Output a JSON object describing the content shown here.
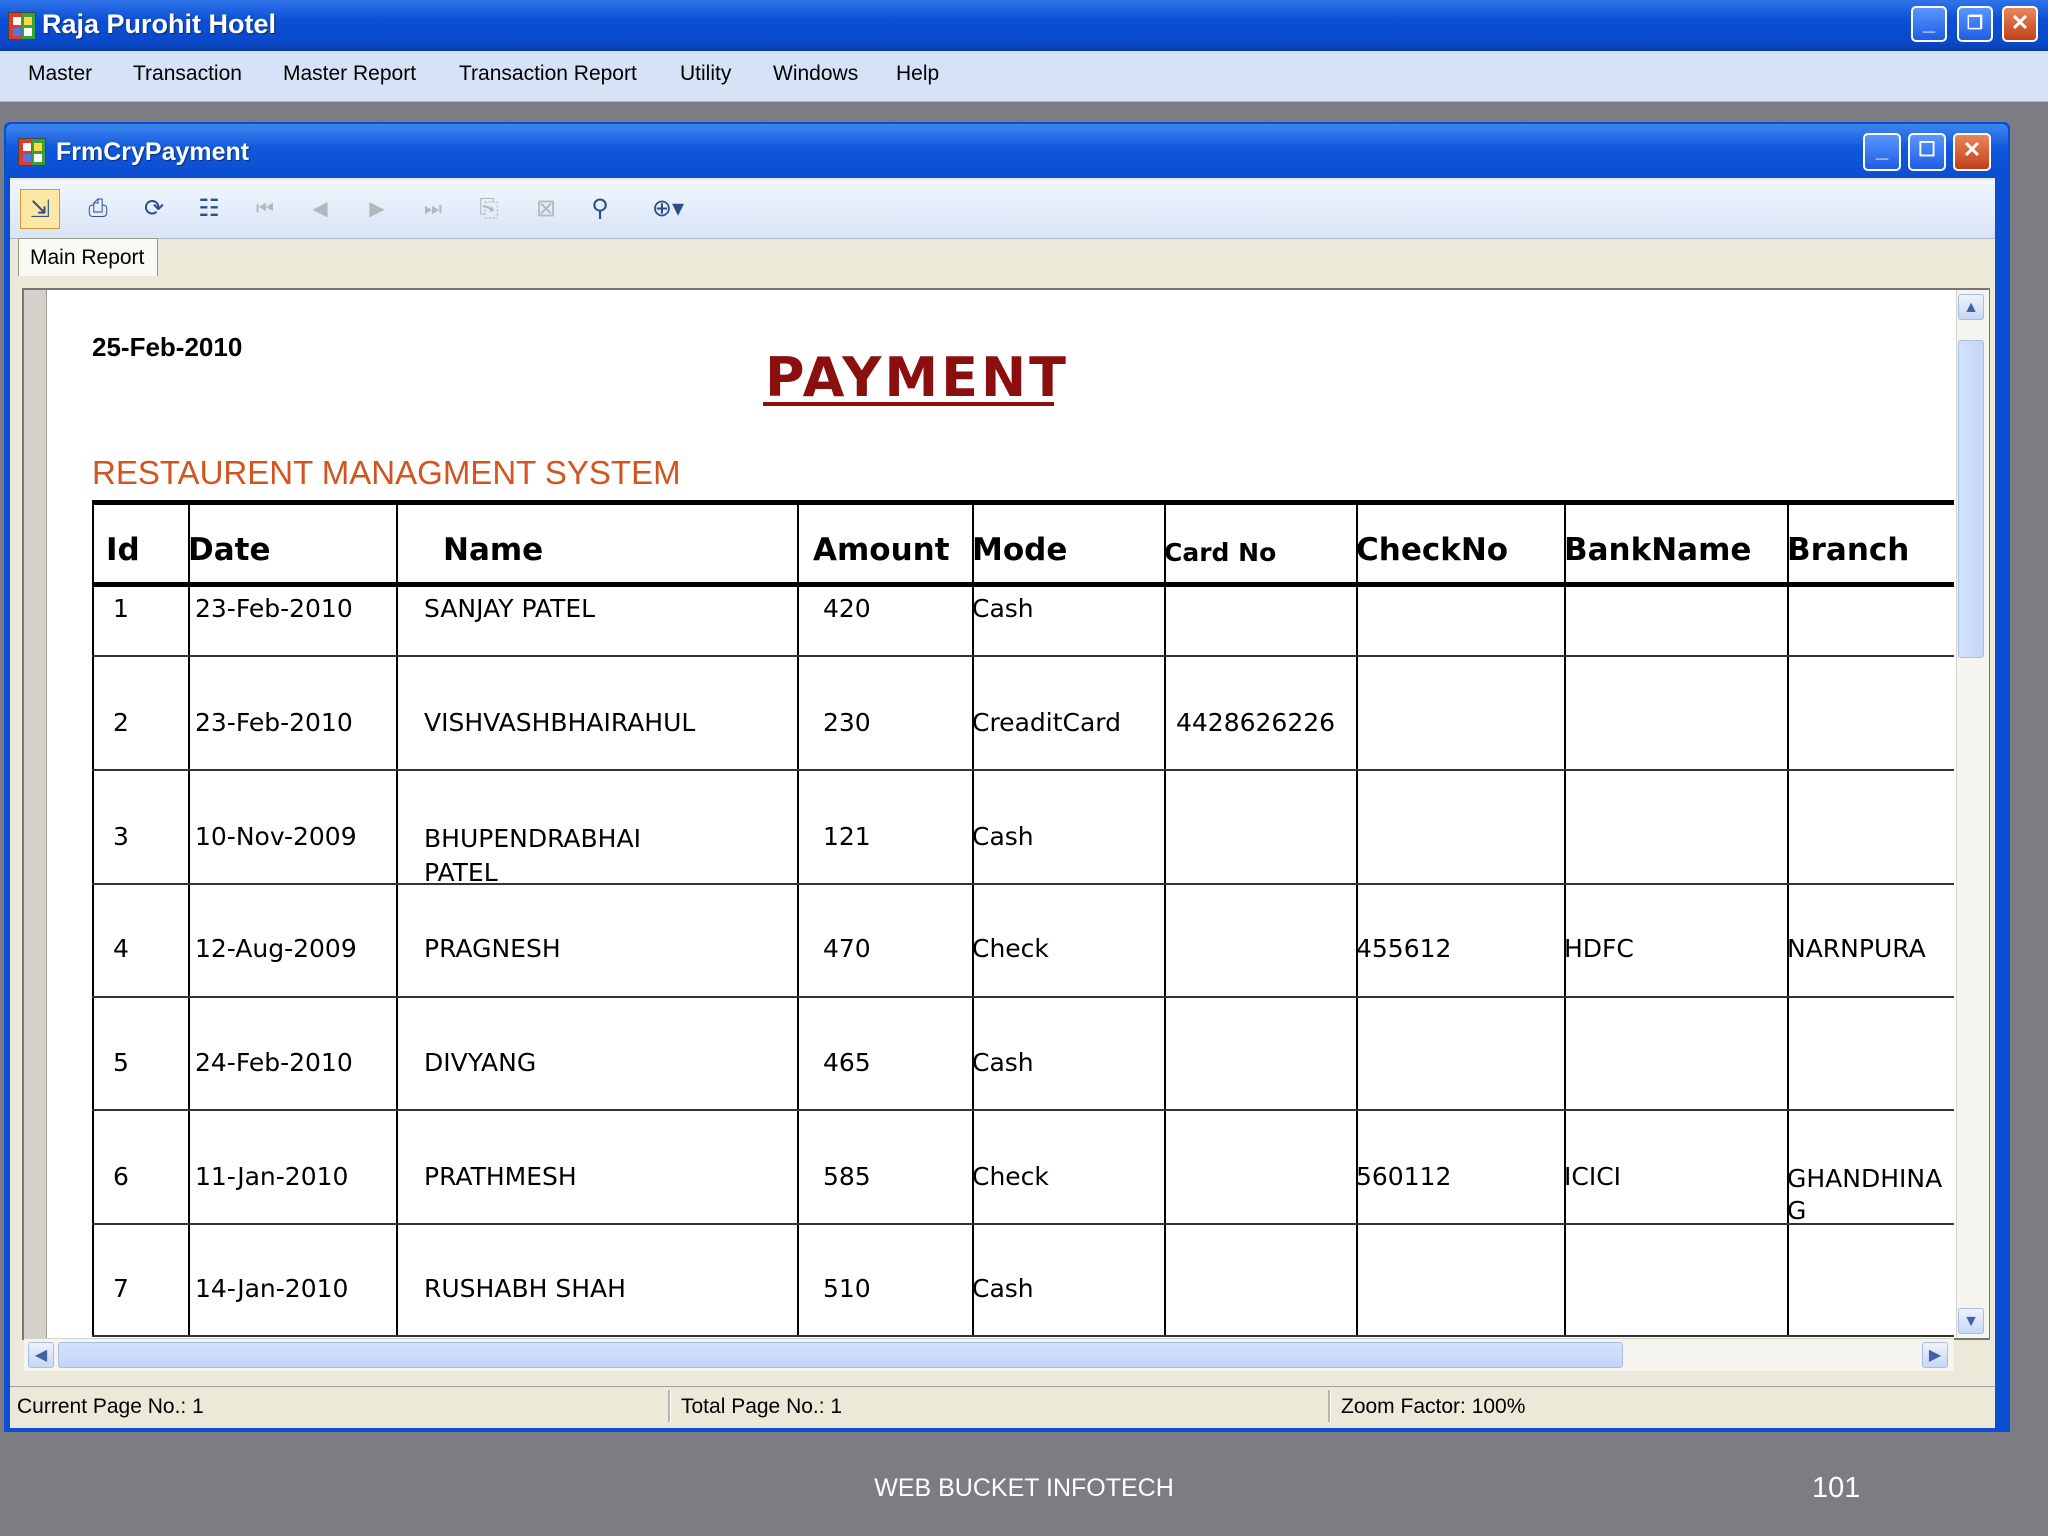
{
  "app": {
    "title": "Raja Purohit Hotel"
  },
  "menu": [
    "Master",
    "Transaction",
    "Master Report",
    "Transaction Report",
    "Utility",
    "Windows",
    "Help"
  ],
  "child": {
    "title": "FrmCryPayment"
  },
  "toolbar": {
    "icons": [
      "export-icon",
      "print-icon",
      "refresh-icon",
      "group-tree-icon",
      "first-page-icon",
      "previous-page-icon",
      "next-page-icon",
      "last-page-icon",
      "goto-page-icon",
      "stop-icon",
      "search-icon",
      "zoom-icon"
    ]
  },
  "tab": {
    "label": "Main Report"
  },
  "report": {
    "date": "25-Feb-2010",
    "title": "PAYMENT",
    "subtitle": "RESTAURENT MANAGMENT SYSTEM",
    "columns": [
      "Id",
      "Date",
      "Name",
      "Amount",
      "Mode",
      "Card No",
      "CheckNo",
      "BankName",
      "Branch"
    ],
    "rows": [
      [
        "1",
        "23-Feb-2010",
        "SANJAY PATEL",
        "420",
        "Cash",
        "",
        "",
        "",
        ""
      ],
      [
        "2",
        "23-Feb-2010",
        "VISHVASHBHAIRAHUL",
        "230",
        "CreaditCard",
        "4428626226",
        "",
        "",
        ""
      ],
      [
        "3",
        "10-Nov-2009",
        "BHUPENDRABHAI",
        "121",
        "Cash",
        "",
        "",
        "",
        ""
      ],
      [
        "4",
        "12-Aug-2009",
        "PRAGNESH",
        "470",
        "Check",
        "",
        "455612",
        "HDFC",
        "NARNPURA"
      ],
      [
        "5",
        "24-Feb-2010",
        "DIVYANG",
        "465",
        "Cash",
        "",
        "",
        "",
        ""
      ],
      [
        "6",
        "11-Jan-2010",
        "PRATHMESH",
        "585",
        "Check",
        "",
        "560112",
        "ICICI",
        "GHANDHINA"
      ],
      [
        "7",
        "14-Jan-2010",
        "RUSHABH SHAH",
        "510",
        "Cash",
        "",
        "",
        "",
        ""
      ]
    ],
    "row3_name_wrap": "PATEL",
    "row6_branch_wrap": "G"
  },
  "status": {
    "current_page": "Current Page No.: 1",
    "total_page": "Total Page No.: 1",
    "zoom": "Zoom Factor: 100%"
  },
  "footer": {
    "company": "WEB BUCKET INFOTECH",
    "page": "101"
  }
}
